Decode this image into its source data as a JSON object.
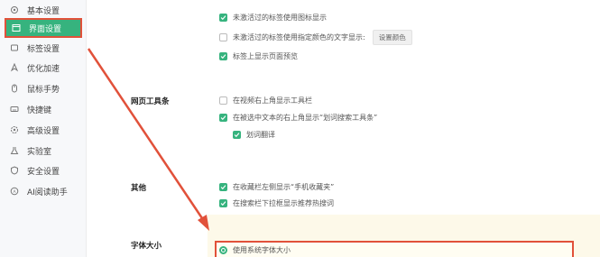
{
  "sidebar": {
    "items": [
      {
        "label": "基本设置",
        "icon": "gear-icon"
      },
      {
        "label": "界面设置",
        "icon": "window-icon"
      },
      {
        "label": "标签设置",
        "icon": "tag-icon"
      },
      {
        "label": "优化加速",
        "icon": "rocket-icon"
      },
      {
        "label": "鼠标手势",
        "icon": "mouse-icon"
      },
      {
        "label": "快捷键",
        "icon": "keyboard-icon"
      },
      {
        "label": "高级设置",
        "icon": "advanced-gear-icon"
      },
      {
        "label": "实验室",
        "icon": "flask-icon"
      },
      {
        "label": "安全设置",
        "icon": "shield-icon"
      },
      {
        "label": "AI阅读助手",
        "icon": "ai-icon"
      }
    ],
    "active_index": 1
  },
  "tab_section": {
    "options": [
      {
        "label": "未激活过的标签使用图标显示",
        "checked": true
      },
      {
        "label": "未激活过的标签使用指定颜色的文字显示:",
        "checked": false,
        "button": "设置颜色"
      },
      {
        "label": "标签上显示页面预览",
        "checked": true
      }
    ]
  },
  "toolbar_section": {
    "title": "网页工具条",
    "options": [
      {
        "label": "在视频右上角显示工具栏",
        "checked": false
      },
      {
        "label": "在被选中文本的右上角显示“划词搜索工具条”",
        "checked": true
      },
      {
        "label": "划词翻译",
        "checked": true
      }
    ]
  },
  "other_section": {
    "title": "其他",
    "options": [
      {
        "label": "在收藏栏左侧显示“手机收藏夹”",
        "checked": true
      },
      {
        "label": "在搜索栏下拉框显示推荐热搜词",
        "checked": true
      }
    ]
  },
  "font_section": {
    "title": "字体大小",
    "options": [
      {
        "label": "使用系统字体大小",
        "selected": true
      }
    ]
  },
  "colors": {
    "accent": "#36b37e",
    "highlight": "#e1513a"
  }
}
